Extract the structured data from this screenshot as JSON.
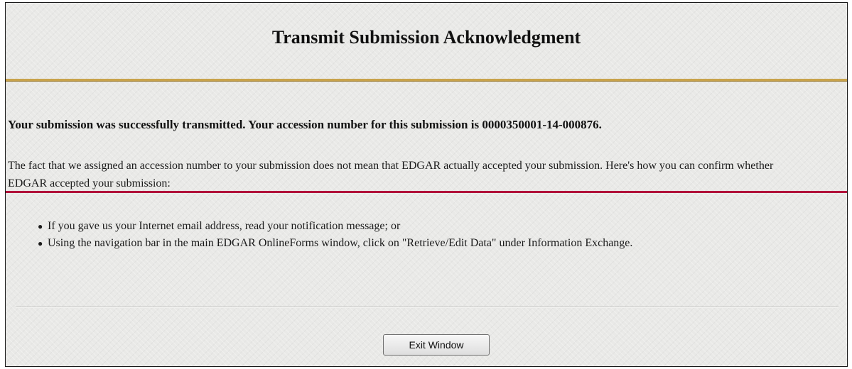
{
  "window": {
    "title": "Transmit Submission Acknowledgment"
  },
  "message": {
    "success": "Your submission was successfully transmitted. Your accession number for this submission is 0000350001-14-000876.",
    "fact": "The fact that we assigned an accession number to your submission does not mean that EDGAR actually accepted your submission. Here's how you can confirm whether EDGAR accepted your submission:"
  },
  "confirm_steps": [
    "If you gave us your Internet email address, read your notification message; or",
    "Using the navigation bar in the main EDGAR OnlineForms window, click on \"Retrieve/Edit Data\" under Information Exchange."
  ],
  "actions": {
    "exit_label": "Exit Window"
  },
  "colors": {
    "gold_rule": "#c8a24a",
    "red_rule": "#b1123a",
    "background": "#e9e9e7"
  }
}
